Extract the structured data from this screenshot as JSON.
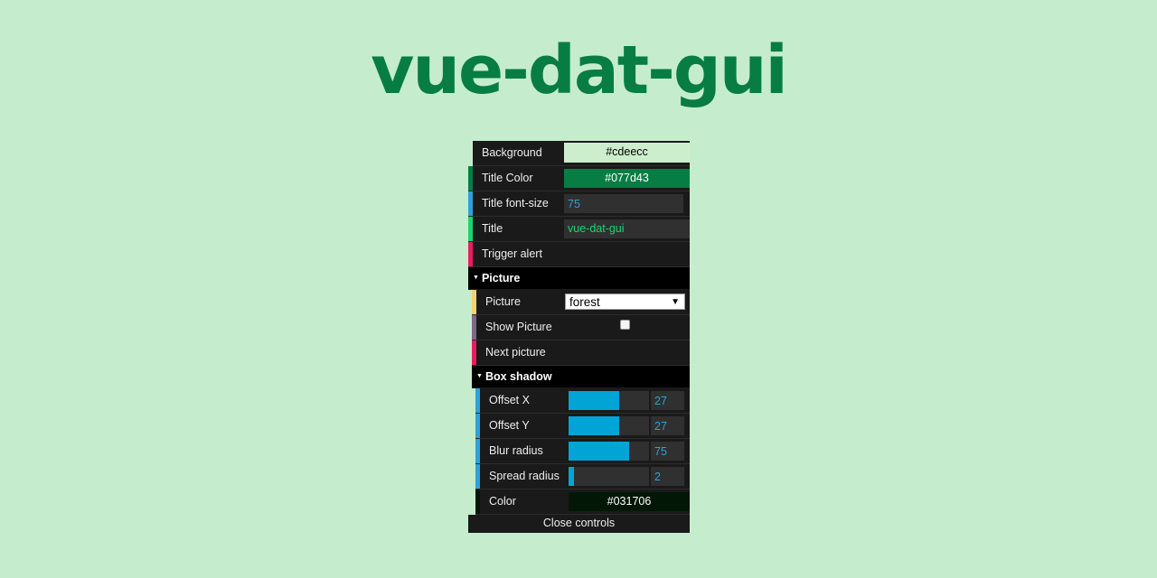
{
  "page": {
    "title": "vue-dat-gui",
    "background": "#c5edcd",
    "title_color": "#077d43"
  },
  "gui": {
    "controls": [
      {
        "label": "Background",
        "type": "color",
        "value": "#cdeecc",
        "stripe": null
      },
      {
        "label": "Title Color",
        "type": "color",
        "value": "#077d43",
        "stripe": "#077d43"
      },
      {
        "label": "Title font-size",
        "type": "number",
        "value": "75",
        "stripe": "#2fa1d6"
      },
      {
        "label": "Title",
        "type": "text",
        "value": "vue-dat-gui",
        "stripe": "#1ed36f"
      },
      {
        "label": "Trigger alert",
        "type": "button",
        "stripe": "#e61d5f"
      }
    ],
    "folders": [
      {
        "title": "Picture",
        "expanded": true,
        "controls": [
          {
            "label": "Picture",
            "type": "select",
            "value": "forest",
            "stripe": "#f0d374"
          },
          {
            "label": "Show Picture",
            "type": "checkbox",
            "checked": false,
            "stripe": "#806787"
          },
          {
            "label": "Next picture",
            "type": "button",
            "stripe": "#e61d5f"
          }
        ]
      },
      {
        "title": "Box shadow",
        "expanded": true,
        "controls": [
          {
            "label": "Offset X",
            "type": "slider",
            "value": "27",
            "fraction": 0.63,
            "stripe": "#2fa1d6"
          },
          {
            "label": "Offset Y",
            "type": "slider",
            "value": "27",
            "fraction": 0.63,
            "stripe": "#2fa1d6"
          },
          {
            "label": "Blur radius",
            "type": "slider",
            "value": "75",
            "fraction": 0.75,
            "stripe": "#2fa1d6"
          },
          {
            "label": "Spread radius",
            "type": "slider",
            "value": "2",
            "fraction": 0.07,
            "stripe": "#2fa1d6"
          },
          {
            "label": "Color",
            "type": "color",
            "value": "#031706",
            "stripe": "#031706"
          }
        ]
      }
    ],
    "close_label": "Close controls",
    "icons": {
      "folder_expanded": "▼",
      "select_arrow": "▼"
    }
  }
}
